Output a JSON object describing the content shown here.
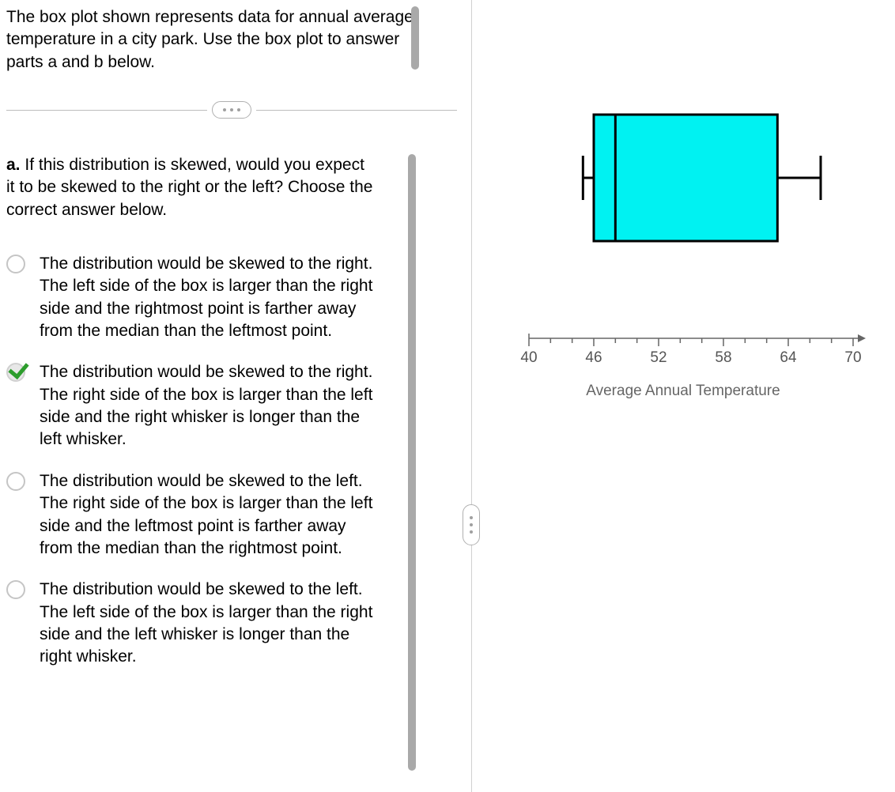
{
  "intro": "The box plot shown represents data for annual average temperature in a city park. Use the box plot to answer parts a and b below.",
  "question": {
    "label": "a.",
    "text": "If this distribution is skewed, would you expect it to be skewed to the right or the left? Choose the correct answer below."
  },
  "options": [
    {
      "text": "The distribution would be skewed to the right. The left side of the box is larger than the right side and the rightmost point is farther away from the median than the leftmost point.",
      "correct": false
    },
    {
      "text": "The distribution would be skewed to the right. The right side of the box is larger than the left side and the right whisker is longer than the left whisker.",
      "correct": true
    },
    {
      "text": "The distribution would be skewed to the left. The right side of the box is larger than the left side and the leftmost point is farther away from the median than the rightmost point.",
      "correct": false
    },
    {
      "text": "The distribution would be skewed to the left. The left side of the box is larger than the right side and the left whisker is longer than the right whisker.",
      "correct": false
    }
  ],
  "chart_data": {
    "type": "boxplot",
    "title": "",
    "xlabel": "Average Annual Temperature",
    "ylabel": "",
    "xlim": [
      40,
      70
    ],
    "ticks": [
      40,
      46,
      52,
      58,
      64,
      70
    ],
    "min": 45,
    "q1": 46,
    "median": 48,
    "q3": 63,
    "max": 67,
    "box_color": "#00f2f2"
  }
}
